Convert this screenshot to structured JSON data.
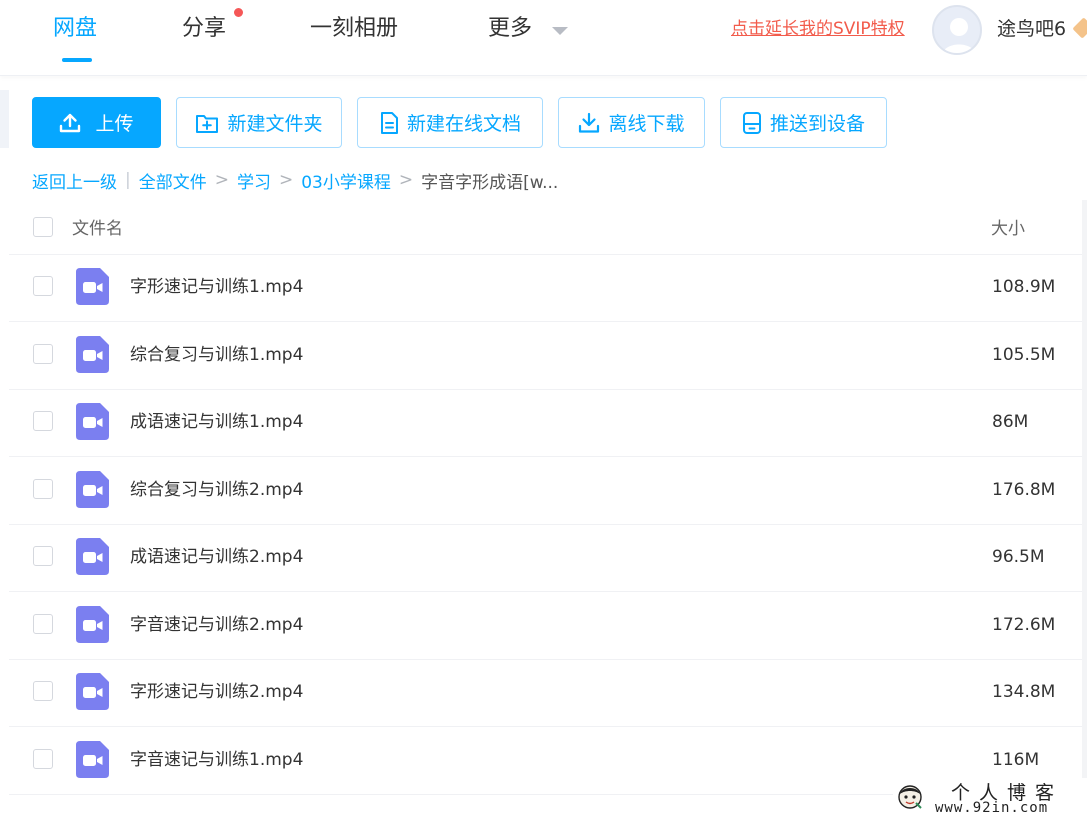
{
  "nav": {
    "items": [
      {
        "label": "网盘",
        "active": true
      },
      {
        "label": "分享",
        "has_dot": true
      },
      {
        "label": "一刻相册"
      },
      {
        "label": "更多",
        "has_caret": true
      }
    ],
    "svip_link": "点击延长我的SVIP特权",
    "username": "途鸟吧6"
  },
  "toolbar": {
    "upload": "上传",
    "new_folder": "新建文件夹",
    "new_doc": "新建在线文档",
    "offline_download": "离线下载",
    "push_device": "推送到设备"
  },
  "breadcrumb": {
    "back": "返回上一级",
    "all_files": "全部文件",
    "level1": "学习",
    "level2": "03小学课程",
    "current": "字音字形成语[w..."
  },
  "list": {
    "header_name": "文件名",
    "header_size": "大小",
    "files": [
      {
        "name": "字形速记与训练1.mp4",
        "size": "108.9M"
      },
      {
        "name": "综合复习与训练1.mp4",
        "size": "105.5M"
      },
      {
        "name": "成语速记与训练1.mp4",
        "size": "86M"
      },
      {
        "name": "综合复习与训练2.mp4",
        "size": "176.8M"
      },
      {
        "name": "成语速记与训练2.mp4",
        "size": "96.5M"
      },
      {
        "name": "字音速记与训练2.mp4",
        "size": "172.6M"
      },
      {
        "name": "字形速记与训练2.mp4",
        "size": "134.8M"
      },
      {
        "name": "字音速记与训练1.mp4",
        "size": "116M"
      }
    ]
  },
  "watermark": {
    "title": "个人博客",
    "url": "www.92in.com"
  },
  "colors": {
    "accent": "#06a7ff",
    "video_icon": "#7b7ff0",
    "svip_link": "#f25b4b",
    "notification_dot": "#f55757"
  },
  "icons": {
    "upload": "upload-icon",
    "new_folder": "folder-plus-icon",
    "new_doc": "document-icon",
    "offline_download": "download-icon",
    "push_device": "device-icon",
    "file": "video-file-icon"
  }
}
